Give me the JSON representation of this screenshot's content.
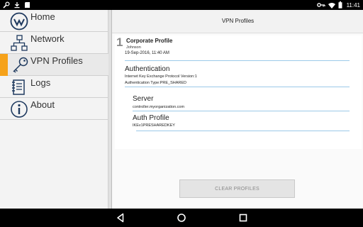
{
  "status_bar": {
    "time": "11:41",
    "left_icons": [
      "wrench-icon",
      "download-icon",
      "sd-card-icon"
    ],
    "right_icons": [
      "vpn-key-icon",
      "wifi-icon",
      "battery-icon"
    ]
  },
  "sidebar": {
    "items": [
      {
        "label": "Home",
        "icon": "logo-icon",
        "active": false
      },
      {
        "label": "Network",
        "icon": "network-icon",
        "active": false
      },
      {
        "label": "VPN Profiles",
        "icon": "key-icon",
        "active": true
      },
      {
        "label": "Logs",
        "icon": "log-icon",
        "active": false
      },
      {
        "label": "About",
        "icon": "info-icon",
        "active": false
      }
    ],
    "accent_color": "#f6a21a"
  },
  "main": {
    "title": "VPN Profiles",
    "profile": {
      "number": "1",
      "name": "Corporate Profile",
      "user": "Johnson",
      "date": "19-Sep-2016, 11:40 AM",
      "authentication": {
        "heading": "Authentication",
        "lines": [
          "Internet Key Exchange Protocol Version:1",
          "Authentication Type:PRE_SHARED"
        ]
      },
      "server": {
        "heading": "Server",
        "value": "controller.myorganization.com"
      },
      "auth_profile": {
        "heading": "Auth Profile",
        "value": "IKEv1PRESHAREDKEY"
      }
    },
    "clear_button_label": "CLEAR PROFILES",
    "divider_color": "#9cc9e8"
  },
  "nav_bar": {
    "buttons": [
      "back-icon",
      "home-circle-icon",
      "recents-icon"
    ]
  }
}
